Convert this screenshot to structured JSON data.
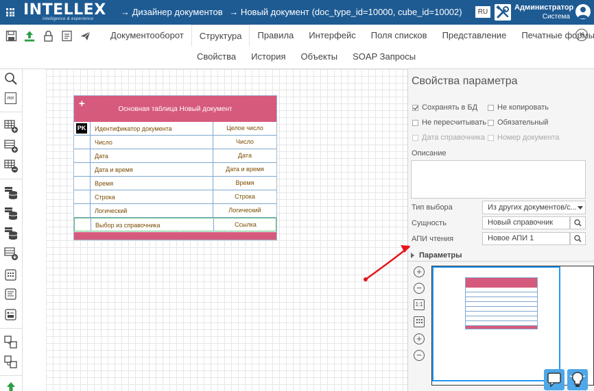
{
  "header": {
    "logo_text": "INTELLEX",
    "logo_tagline": "intelligence & experience",
    "breadcrumbs": [
      "→  Дизайнер документов",
      "→  Новый документ (doc_type_id=10000, cube_id=10002)"
    ],
    "language": "RU",
    "user_name": "Администратор",
    "user_role": "Система"
  },
  "toolbar": {
    "icons": [
      "save-icon",
      "upload-icon",
      "lock-icon",
      "document-list-icon",
      "send-icon"
    ]
  },
  "tabs": [
    "Документооборот",
    "Структура",
    "Правила",
    "Интерфейс",
    "Поля списков",
    "Представление",
    "Печатные формы"
  ],
  "active_tab": "Структура",
  "subtabs": [
    "Свойства",
    "История",
    "Объекты",
    "SOAP Запросы"
  ],
  "left_toolbar": {
    "items": [
      "search-icon",
      "log-icon",
      "add-table-icon",
      "add-row-icon",
      "remove-table-icon",
      "database-icon",
      "database-add-icon",
      "database-list-icon",
      "add-field-icon",
      "grid-icon",
      "text-list-icon",
      "form-icon",
      "copy-icon",
      "link-icon",
      "arrow-up-icon"
    ],
    "log_label": "лог"
  },
  "entity": {
    "add_label": "+",
    "title": "Основная таблица Новый документ",
    "pk_label": "PK",
    "rows": [
      {
        "name": "Идентификатор документа",
        "type": "Целое число"
      },
      {
        "name": "Число",
        "type": "Число"
      },
      {
        "name": "Дата",
        "type": "Дата"
      },
      {
        "name": "Дата и время",
        "type": "Дата и время"
      },
      {
        "name": "Время",
        "type": "Время"
      },
      {
        "name": "Строка",
        "type": "Строка"
      },
      {
        "name": "Логический",
        "type": "Логический"
      },
      {
        "name": "Выбор из справочника",
        "type": "Ссылка"
      }
    ],
    "header_color": "#d65a7c"
  },
  "panel": {
    "title": "Свойства параметра",
    "checkboxes": [
      {
        "label": "Сохранять в БД",
        "checked": true,
        "disabled": false
      },
      {
        "label": "Не копировать",
        "checked": false,
        "disabled": false
      },
      {
        "label": "Не пересчитывать",
        "checked": false,
        "disabled": false
      },
      {
        "label": "Обязательный",
        "checked": false,
        "disabled": false
      },
      {
        "label": "Дата справочника",
        "checked": false,
        "disabled": true
      },
      {
        "label": "Номер документа",
        "checked": false,
        "disabled": true
      }
    ],
    "description_label": "Описание",
    "description_value": "",
    "select_type_label": "Тип выбора",
    "select_type_value": "Из других документов/с...",
    "entity_label": "Сущность",
    "entity_value": "Новый справочник",
    "api_label": "АПИ чтения",
    "api_value": "Новое АПИ 1",
    "section_label": "Параметры",
    "minimap_buttons": [
      "zoom-in-icon",
      "zoom-out-icon",
      "actual-size-icon",
      "grid-icon",
      "expand-icon",
      "collapse-icon"
    ],
    "actual_size_label": "1:1"
  },
  "colors": {
    "topbar": "#1e5b93",
    "accent": "#2196f3",
    "annotation_arrow": "#e5141b"
  }
}
